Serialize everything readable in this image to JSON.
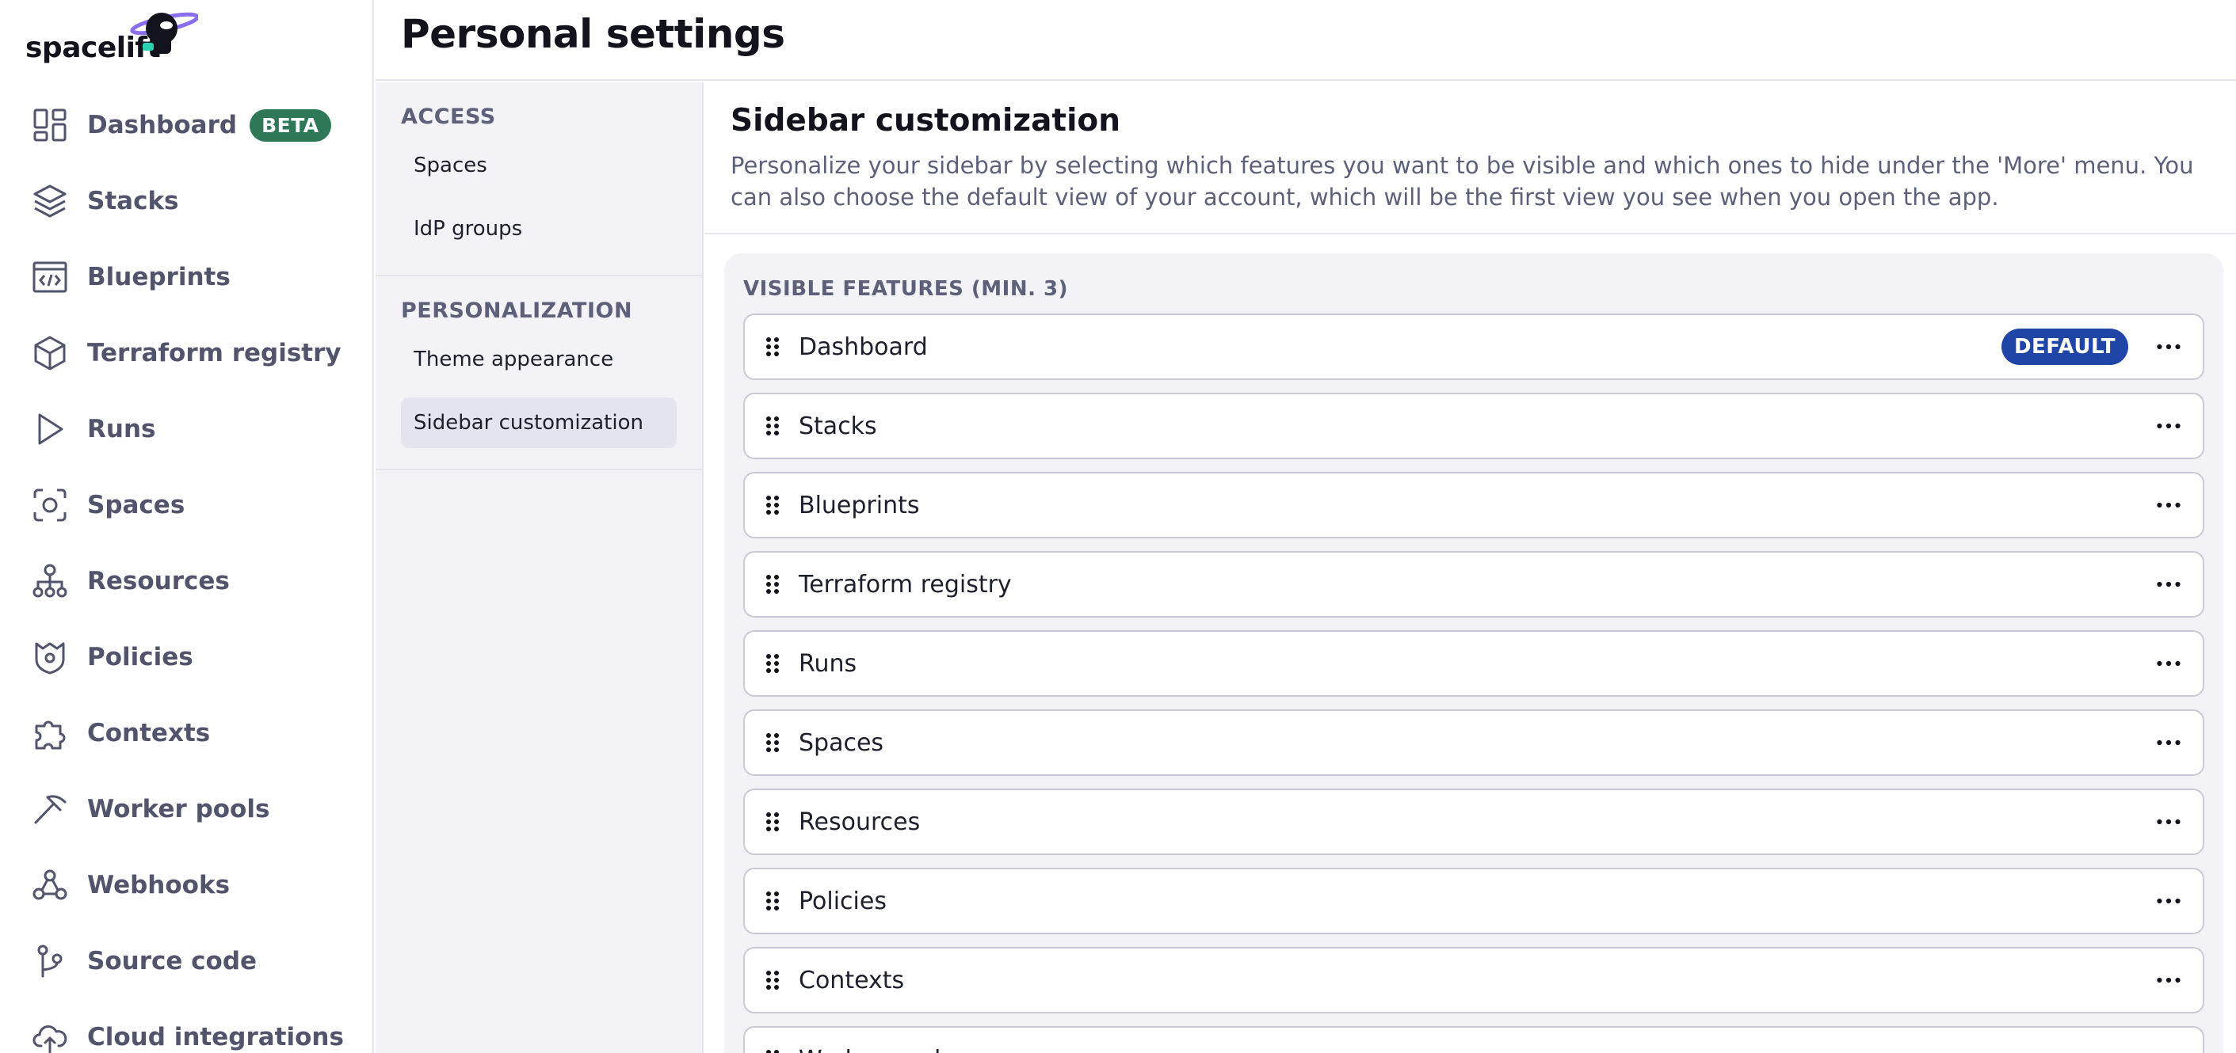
{
  "brand": {
    "name": "spacelift"
  },
  "header": {
    "title": "Personal settings"
  },
  "sidebar": {
    "items": [
      {
        "label": "Dashboard",
        "icon": "dashboard-icon",
        "badge": "BETA"
      },
      {
        "label": "Stacks",
        "icon": "stacks-icon"
      },
      {
        "label": "Blueprints",
        "icon": "blueprints-icon"
      },
      {
        "label": "Terraform registry",
        "icon": "terraform-registry-icon"
      },
      {
        "label": "Runs",
        "icon": "runs-icon"
      },
      {
        "label": "Spaces",
        "icon": "spaces-icon"
      },
      {
        "label": "Resources",
        "icon": "resources-icon"
      },
      {
        "label": "Policies",
        "icon": "policies-icon"
      },
      {
        "label": "Contexts",
        "icon": "contexts-icon"
      },
      {
        "label": "Worker pools",
        "icon": "worker-pools-icon"
      },
      {
        "label": "Webhooks",
        "icon": "webhooks-icon"
      },
      {
        "label": "Source code",
        "icon": "source-code-icon"
      },
      {
        "label": "Cloud integrations",
        "icon": "cloud-integrations-icon"
      }
    ]
  },
  "subnav": {
    "access": {
      "heading": "ACCESS",
      "items": [
        "Spaces",
        "IdP groups"
      ]
    },
    "personalization": {
      "heading": "PERSONALIZATION",
      "items": [
        "Theme appearance",
        "Sidebar customization"
      ],
      "active": "Sidebar customization"
    }
  },
  "main": {
    "title": "Sidebar customization",
    "description": "Personalize your sidebar by selecting which features you want to be visible and which ones to hide under the 'More' menu. You can also choose the default view of your account, which will be the first view you see when you open the app.",
    "panel_heading": "VISIBLE FEATURES (MIN. 3)",
    "default_badge": "DEFAULT",
    "features": [
      "Dashboard",
      "Stacks",
      "Blueprints",
      "Terraform registry",
      "Runs",
      "Spaces",
      "Resources",
      "Policies",
      "Contexts",
      "Worker pools"
    ]
  },
  "colors": {
    "beta_badge": "#2f7857",
    "default_badge": "#1f46a6",
    "nav_text": "#51546b",
    "panel_bg": "#f3f3f7"
  }
}
